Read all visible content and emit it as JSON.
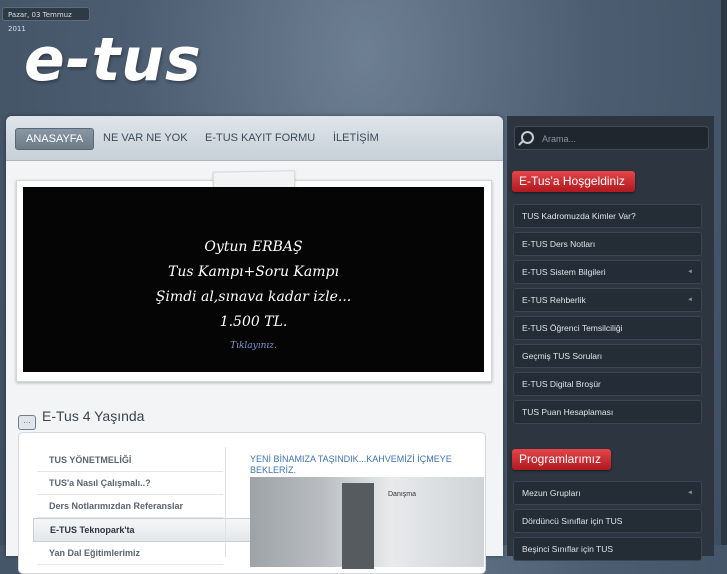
{
  "header": {
    "date": "Pazar, 03 Temmuz 2011",
    "logo": "e-tus"
  },
  "nav": {
    "items": [
      "ANASAYFA",
      "NE VAR NE YOK",
      "E-TUS KAYIT FORMU",
      "İLETİŞİM"
    ]
  },
  "slider": {
    "lines": [
      "Oytun ERBAŞ",
      "Tus Kampı+Soru Kampı",
      "Şimdi al,sınava kadar izle...",
      "1.500 TL."
    ],
    "cta": "Tıklayınız."
  },
  "section": {
    "icon": "speech-bubble-icon",
    "title": "E-Tus 4 Yaşında"
  },
  "box": {
    "menu": [
      "TUS YÖNETMELİĞİ",
      "TUS'a Nasıl Çalışmalı..?",
      "Ders Notlarımızdan Referanslar",
      "E-TUS Teknopark'ta",
      "Yan Dal Eğitimlerimiz"
    ],
    "active_index": 3,
    "news_link": "YENİ BİNAMIZA TAŞINDIK...KAHVEMİZİ İÇMEYE BEKLERİZ.",
    "photo_sign": "Danışma"
  },
  "sidebar": {
    "search_placeholder": "Arama...",
    "welcome_title": "E-Tus'a Hoşgeldiniz",
    "welcome_items": [
      {
        "label": "TUS Kadromuzda Kimler Var?",
        "has_arrow": false
      },
      {
        "label": "E-TUS Ders Notları",
        "has_arrow": false
      },
      {
        "label": "E-TUS Sistem Bilgileri",
        "has_arrow": true
      },
      {
        "label": "E-TUS Rehberlik",
        "has_arrow": true
      },
      {
        "label": "E-TUS Öğrenci Temsilciliği",
        "has_arrow": false
      },
      {
        "label": "Geçmiş TUS Soruları",
        "has_arrow": false
      },
      {
        "label": "E-TUS Digital Broşür",
        "has_arrow": false
      },
      {
        "label": "TUS Puan Hesaplaması",
        "has_arrow": false
      }
    ],
    "programs_title": "Programlarımız",
    "program_items": [
      {
        "label": "Mezun Grupları",
        "has_arrow": true
      },
      {
        "label": "Dördüncü Sınıflar için TUS",
        "has_arrow": false
      },
      {
        "label": "Beşinci Sınıflar için TUS",
        "has_arrow": false
      }
    ],
    "arrow_glyph": "◄"
  },
  "colors": {
    "accent_red": "#c4262b",
    "nav_active": "#7a8896",
    "link_blue": "#3c73b8"
  }
}
